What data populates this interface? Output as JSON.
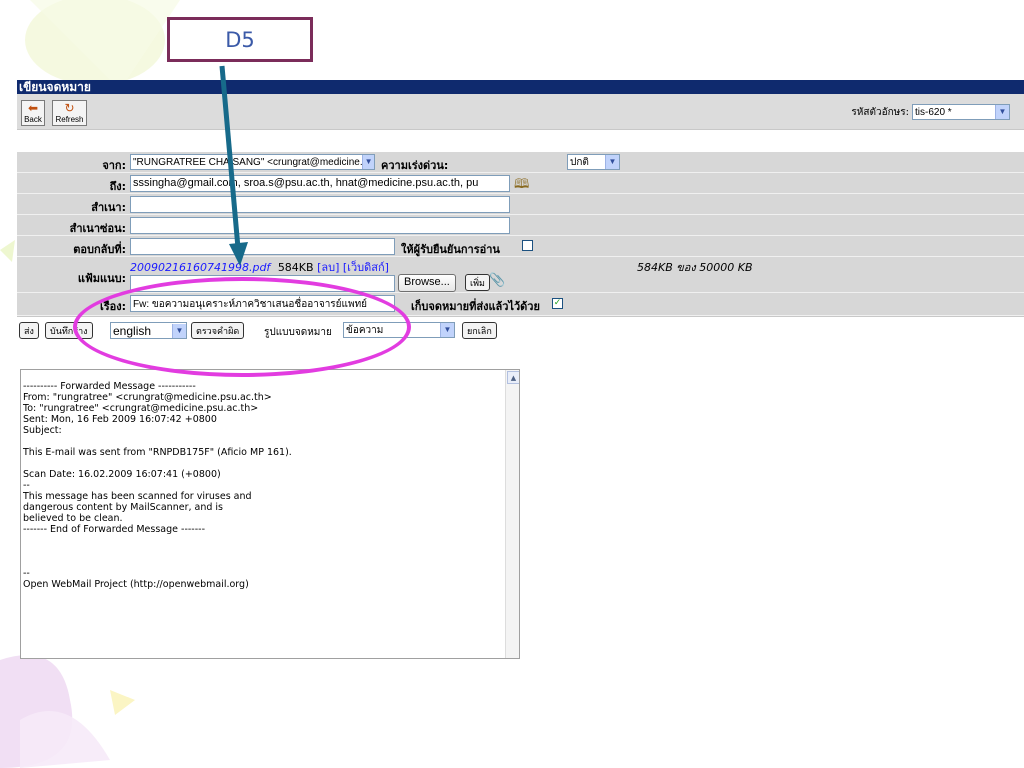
{
  "callout_label": "D5",
  "window": {
    "title": "เขียนจดหมาย"
  },
  "toolbar": {
    "back_label": "Back",
    "refresh_label": "Refresh",
    "charset_label": "รหัสตัวอักษร:",
    "charset_value": "tis-620 *"
  },
  "form": {
    "from_label": "จาก:",
    "from_value": "\"RUNGRATREE CHAISANG\" <crungrat@medicine.psu.ac.th>",
    "priority_label": "ความเร่งด่วน:",
    "priority_value": "ปกติ",
    "to_label": "ถึง:",
    "to_value": "sssingha@gmail.com, sroa.s@psu.ac.th,  hnat@medicine.psu.ac.th, pu",
    "cc_label": "สำเนา:",
    "cc_value": "",
    "bcc_label": "สำเนาซ่อน:",
    "bcc_value": "",
    "replyto_label": "ตอบกลับที่:",
    "replyto_value": "",
    "receipt_label": "ให้ผู้รับยืนยันการอ่าน",
    "attach_label": "แฟ้มแนบ:",
    "attach_filename": "20090216160741998.pdf",
    "attach_size": "584KB",
    "attach_delete": "[ลบ]",
    "attach_webdisk": "[เว็บดิสก์]",
    "attach_quota": "584KB ของ 50000 KB",
    "browse_label": "Browse...",
    "add_label": "เพิ่ม",
    "subject_label": "เรื่อง:",
    "subject_value": "Fw: ขอความอนุเคราะห์ภาควิชาเสนอชื่ออาจารย์แพทย์",
    "save_sent_label": "เก็บจดหมายที่ส่งแล้วไว้ด้วย"
  },
  "actions": {
    "send": "ส่ง",
    "save_draft": "บันทึกร่าง",
    "language": "english",
    "spellcheck": "ตรวจคำผิด",
    "format_label": "รูปแบบจดหมาย",
    "format_value": "ข้อความ",
    "cancel": "ยกเลิก"
  },
  "body_lines": [
    "",
    "---------- Forwarded Message -----------",
    "From: \"rungratree\" <crungrat@medicine.psu.ac.th>",
    "To: \"rungratree\" <crungrat@medicine.psu.ac.th>",
    "Sent: Mon, 16 Feb 2009 16:07:42 +0800",
    "Subject:",
    "",
    "This E-mail was sent from \"RNPDB175F\" (Aficio MP 161).",
    "",
    "Scan Date: 16.02.2009 16:07:41 (+0800)",
    "--",
    "This message has been scanned for viruses and",
    "dangerous content by MailScanner, and is",
    "believed to be clean.",
    "------- End of Forwarded Message -------",
    "",
    "",
    "",
    "--",
    "Open WebMail Project (http://openwebmail.org)"
  ],
  "colors": {
    "titlebar": "#0f2a6e",
    "form_bg": "#d7d7d7",
    "highlight_ellipse": "#e23ce0",
    "arrow": "#176a8a",
    "callout_border": "#7b2c5a"
  }
}
